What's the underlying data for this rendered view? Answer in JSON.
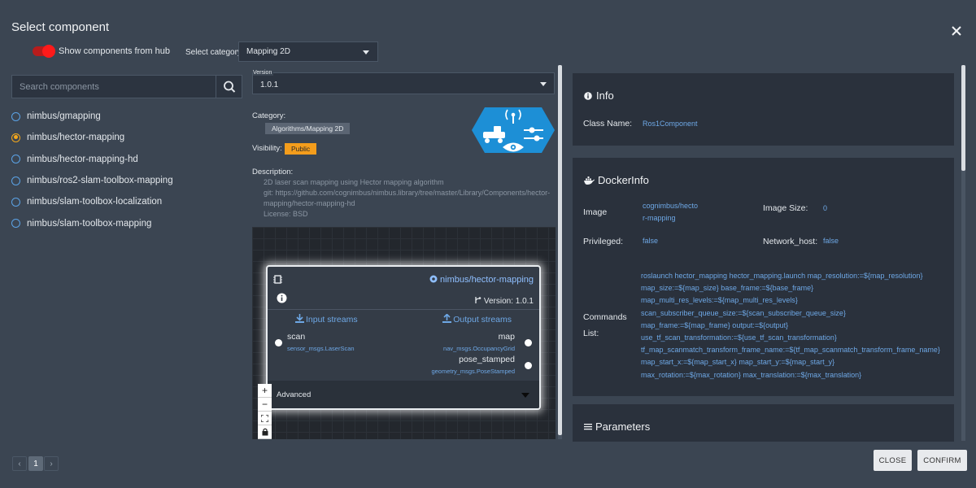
{
  "dialog": {
    "title": "Select component"
  },
  "hub": {
    "label": "Show components from hub",
    "enabled": true
  },
  "category": {
    "label": "Select category",
    "selected": "Mapping 2D"
  },
  "search": {
    "placeholder": "Search components"
  },
  "components": [
    {
      "name": "nimbus/gmapping",
      "selected": false
    },
    {
      "name": "nimbus/hector-mapping",
      "selected": true
    },
    {
      "name": "nimbus/hector-mapping-hd",
      "selected": false
    },
    {
      "name": "nimbus/ros2-slam-toolbox-mapping",
      "selected": false
    },
    {
      "name": "nimbus/slam-toolbox-localization",
      "selected": false
    },
    {
      "name": "nimbus/slam-toolbox-mapping",
      "selected": false
    }
  ],
  "pagination": {
    "prev": "‹",
    "current": "1",
    "next": "›"
  },
  "details": {
    "version_label": "Version",
    "version": "1.0.1",
    "category_label": "Category:",
    "category": "Algorithms/Mapping 2D",
    "visibility_label": "Visibility:",
    "visibility": "Public",
    "description_label": "Description:",
    "description": [
      "2D laser scan mapping using Hector mapping algorithm",
      "git: https://github.com/cognimbus/nimbus.library/tree/master/Library/Components/hector-mapping/hector-mapping-hd",
      "License: BSD"
    ]
  },
  "node": {
    "name": "nimbus/hector-mapping",
    "version": "Version: 1.0.1",
    "input_header": "Input streams",
    "output_header": "Output streams",
    "inputs": [
      {
        "name": "scan",
        "type": "sensor_msgs.LaserScan"
      }
    ],
    "outputs": [
      {
        "name": "map",
        "type": "nav_msgs.OccupancyGrid"
      },
      {
        "name": "pose_stamped",
        "type": "geometry_msgs.PoseStamped"
      }
    ],
    "advanced": "Advanced"
  },
  "zoom": {
    "in": "+",
    "out": "−"
  },
  "info": {
    "title": "Info",
    "class_name_label": "Class Name:",
    "class_name": "Ros1Component"
  },
  "docker": {
    "title": "DockerInfo",
    "image_label": "Image",
    "image": [
      "cognimbus/hecto",
      "r-mapping"
    ],
    "image_size_label": "Image Size:",
    "image_size": "0",
    "privileged_label": "Privileged:",
    "privileged": "false",
    "network_host_label": "Network_host:",
    "network_host": "false",
    "commands_label": [
      "Commands",
      "List:"
    ],
    "commands": "roslaunch hector_mapping hector_mapping.launch map_resolution:=${map_resolution} map_size:=${map_size} base_frame:=${base_frame} map_multi_res_levels:=${map_multi_res_levels} scan_subscriber_queue_size:=${scan_subscriber_queue_size} map_frame:=${map_frame} output:=${output} use_tf_scan_transformation:=${use_tf_scan_transformation} tf_map_scanmatch_transform_frame_name:=${tf_map_scanmatch_transform_frame_name} map_start_x:=${map_start_x} map_start_y:=${map_start_y} max_rotation:=${max_rotation} max_translation:=${max_translation}"
  },
  "parameters": {
    "title": "Parameters"
  },
  "buttons": {
    "close": "CLOSE",
    "confirm": "CONFIRM"
  },
  "colors": {
    "accent": "#6ea8e6",
    "selected_radio": "#f4a81c",
    "toggle": "#ff1a1a",
    "public_badge": "#f49d1c",
    "logo": "#1d8fd6"
  }
}
